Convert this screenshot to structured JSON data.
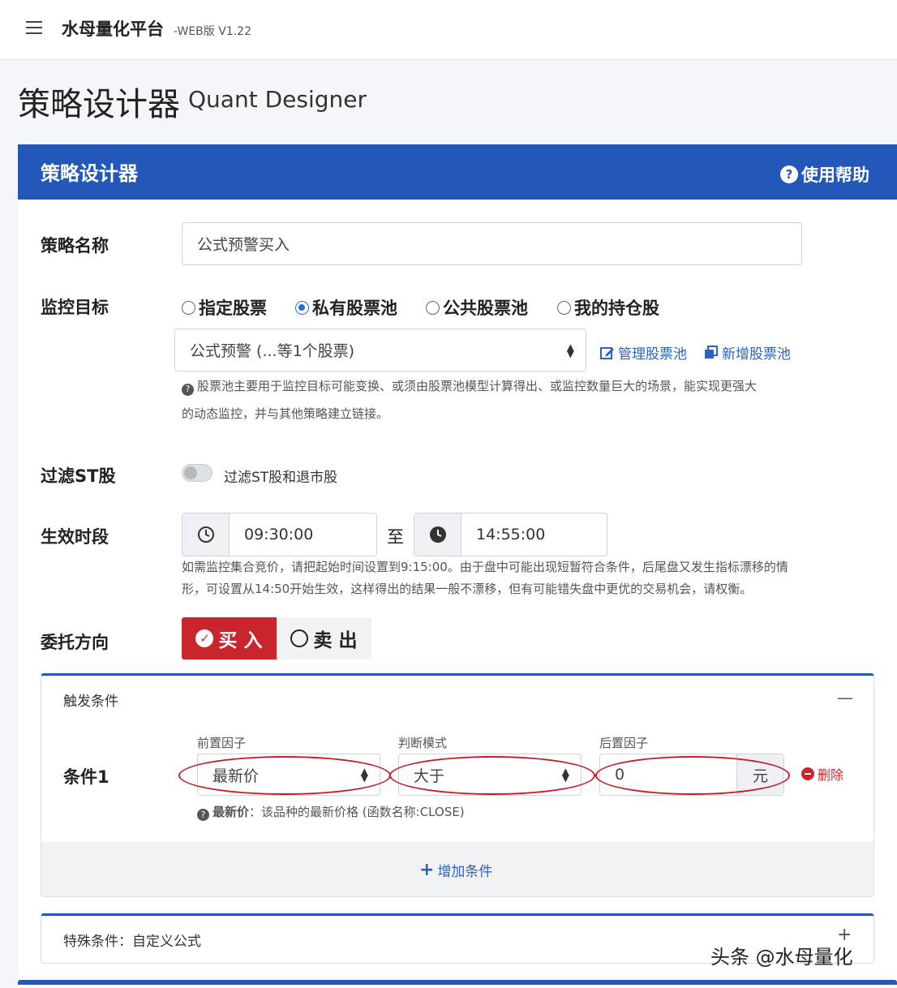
{
  "app": {
    "title": "水母量化平台",
    "version": "-WEB版 V1.22"
  },
  "page": {
    "heading": "策略设计器",
    "heading_en": "Quant Designer"
  },
  "card": {
    "title": "策略设计器",
    "help_label": "使用帮助",
    "help_icon": "?"
  },
  "form": {
    "strategy_name": {
      "label": "策略名称",
      "value": "公式预警买入"
    },
    "monitor_target": {
      "label": "监控目标",
      "options": [
        "指定股票",
        "私有股票池",
        "公共股票池",
        "我的持仓股"
      ],
      "selected": "私有股票池",
      "pool_select": "公式预警 (...等1个股票)",
      "manage_link": "管理股票池",
      "add_link": "新增股票池",
      "hint_line1": "股票池主要用于监控目标可能变换、或须由股票池模型计算得出、或监控数量巨大的场景，能实现更强大",
      "hint_line2": "的动态监控，并与其他策略建立链接。"
    },
    "filter_st": {
      "label": "过滤ST股",
      "toggle_label": "过滤ST股和退市股",
      "enabled": false
    },
    "effective_period": {
      "label": "生效时段",
      "start": "09:30:00",
      "separator": "至",
      "end": "14:55:00",
      "hint_line1": "如需监控集合竞价，请把起始时间设置到9:15:00。由于盘中可能出现短暂符合条件，后尾盘又发生指标漂移的情",
      "hint_line2": "形，可设置从14:50开始生效，这样得出的结果一般不漂移，但有可能错失盘中更优的交易机会，请权衡。"
    },
    "direction": {
      "label": "委托方向",
      "buy": "买 入",
      "sell": "卖 出",
      "selected": "买 入"
    }
  },
  "trigger": {
    "title": "触发条件",
    "collapse_icon": "—",
    "condition": {
      "label": "条件1",
      "pre_factor_label": "前置因子",
      "pre_factor": "最新价",
      "mode_label": "判断模式",
      "mode": "大于",
      "post_factor_label": "后置因子",
      "post_value": "0",
      "unit": "元",
      "delete": "删除",
      "hint_bold": "最新价",
      "hint_rest": "：该品种的最新价格 (函数名称:CLOSE)"
    },
    "add_condition": "增加条件"
  },
  "special": {
    "title": "特殊条件：自定义公式",
    "expand_icon": "+"
  },
  "watermark": "头条 @水母量化",
  "colors": {
    "primary": "#2357b8",
    "buy_red": "#c9252d",
    "annotation_red": "#c61d26",
    "link_blue": "#2a62c8"
  }
}
